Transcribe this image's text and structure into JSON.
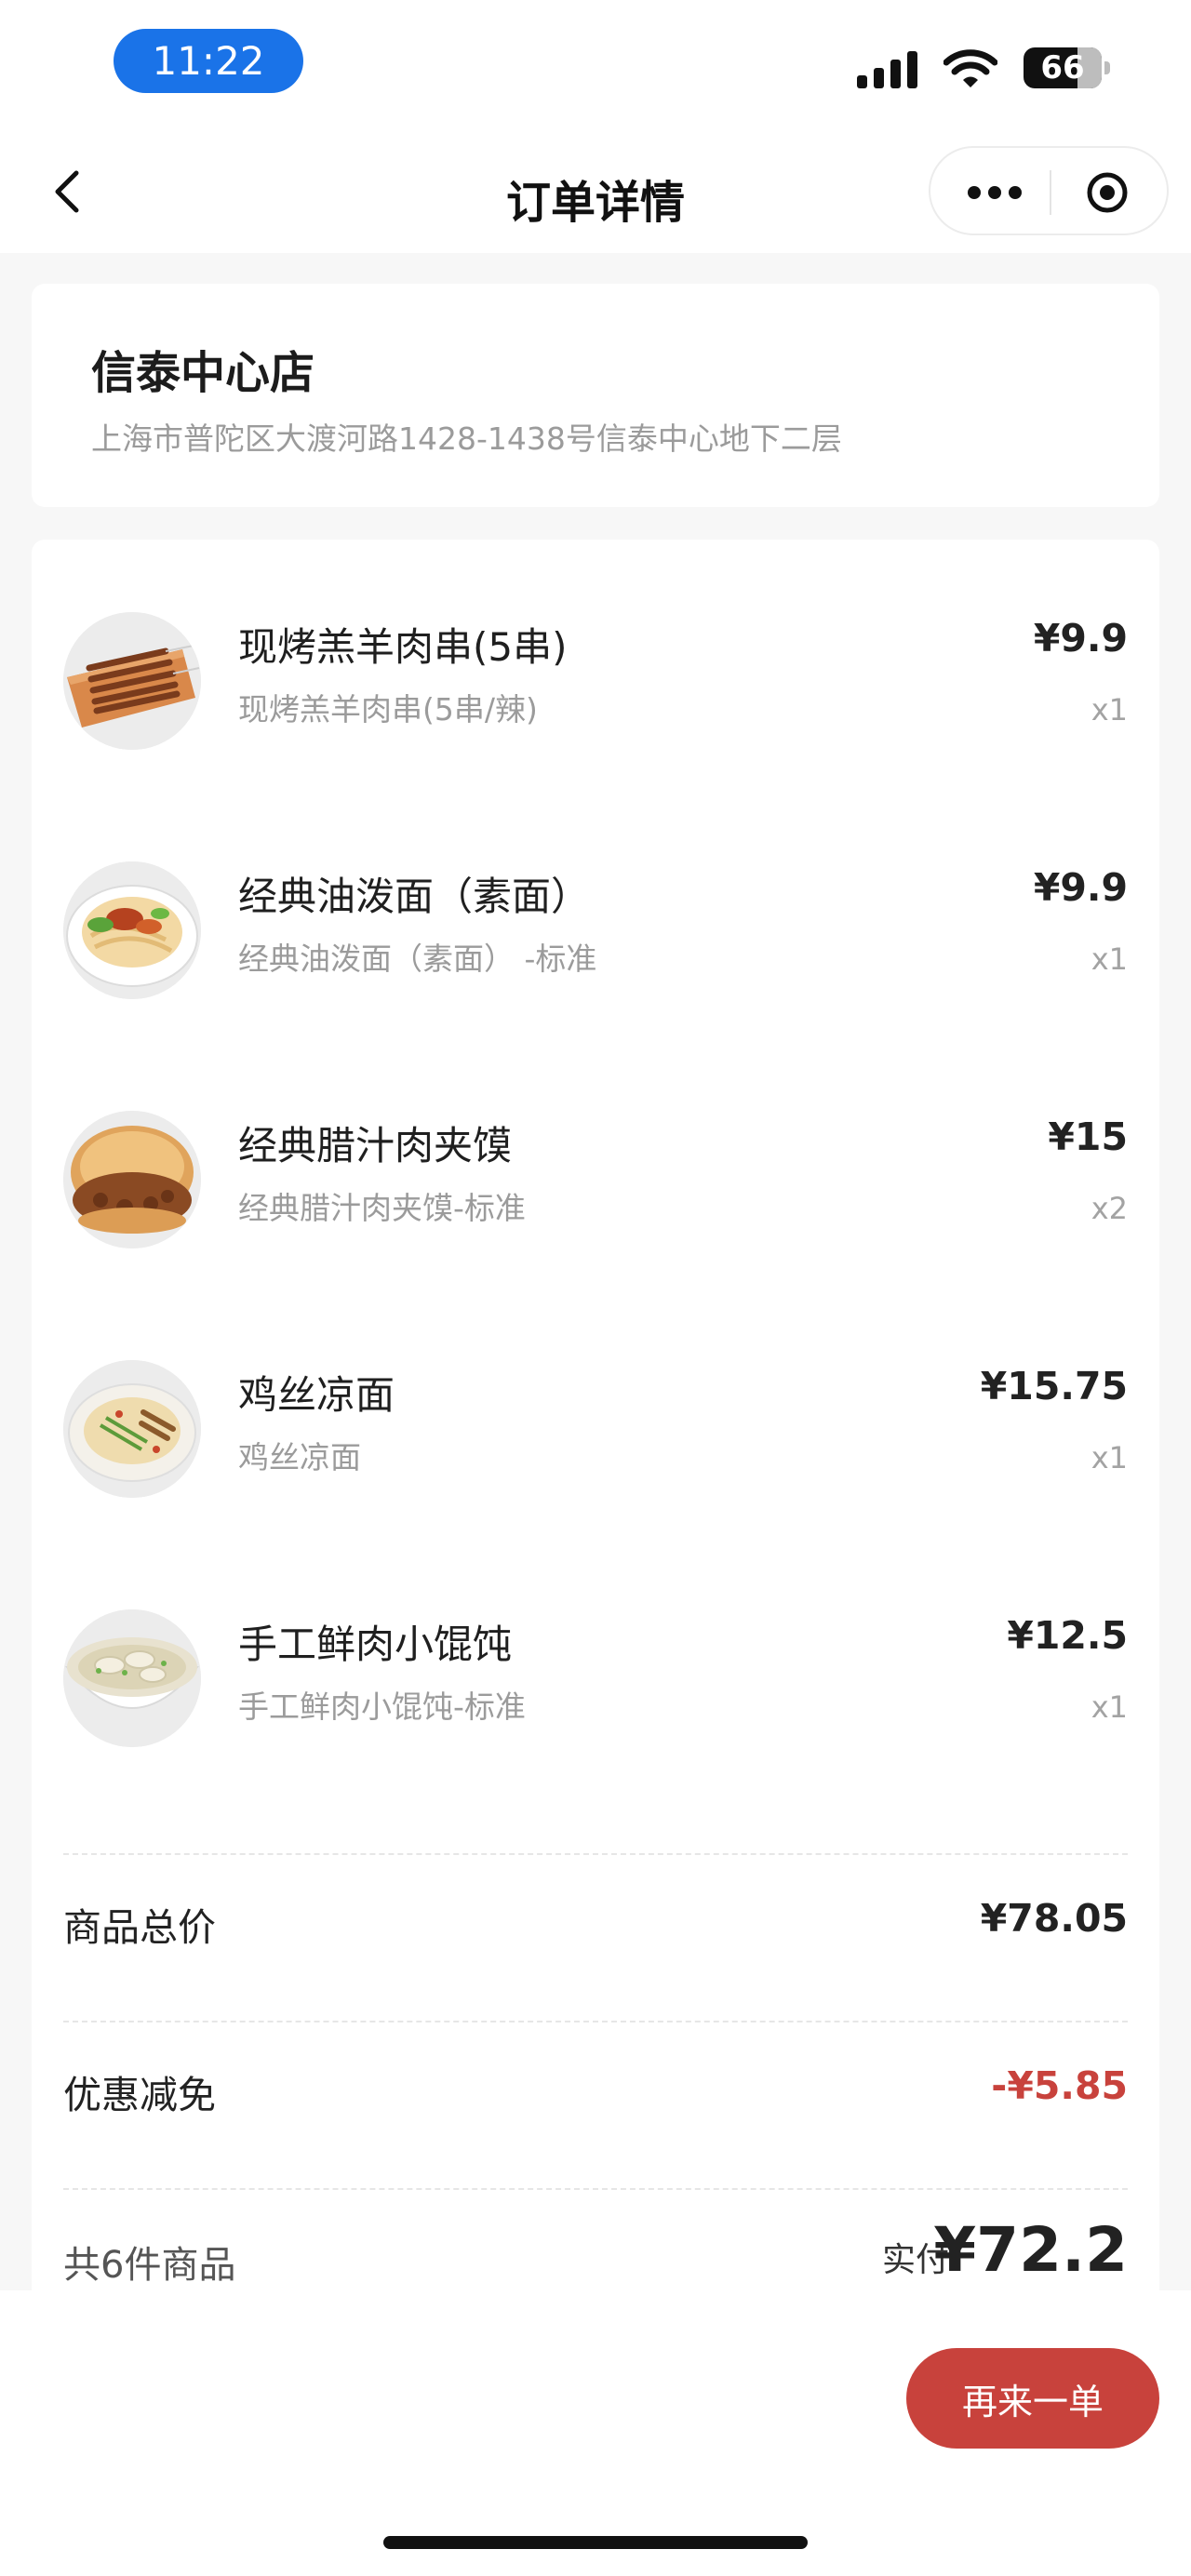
{
  "status_bar": {
    "time": "11:22",
    "battery": "66",
    "icons": [
      "signal-icon",
      "wifi-icon",
      "battery-icon"
    ]
  },
  "nav": {
    "title": "订单详情",
    "back_icon": "chevron-left-icon",
    "more_icon": "more-dots-icon",
    "close_icon": "target-circle-icon"
  },
  "store": {
    "name": "信泰中心店",
    "address": "上海市普陀区大渡河路1428-1438号信泰中心地下二层"
  },
  "items": [
    {
      "name": "现烤羔羊肉串(5串)",
      "spec": "现烤羔羊肉串(5串/辣)",
      "price": "¥9.9",
      "qty": "x1",
      "image": "lamb-skewers"
    },
    {
      "name": "经典油泼面（素面）",
      "spec": "经典油泼面（素面） -标准",
      "price": "¥9.9",
      "qty": "x1",
      "image": "oil-noodles"
    },
    {
      "name": "经典腊汁肉夹馍",
      "spec": "经典腊汁肉夹馍-标准",
      "price": "¥15",
      "qty": "x2",
      "image": "roujiamo"
    },
    {
      "name": "鸡丝凉面",
      "spec": "鸡丝凉面",
      "price": "¥15.75",
      "qty": "x1",
      "image": "cold-noodles"
    },
    {
      "name": "手工鲜肉小馄饨",
      "spec": "手工鲜肉小馄饨-标准",
      "price": "¥12.5",
      "qty": "x1",
      "image": "wonton-soup"
    }
  ],
  "summary": {
    "subtotal_label": "商品总价",
    "subtotal_value": "¥78.05",
    "discount_label": "优惠减免",
    "discount_value": "-¥5.85",
    "count_text": "共6件商品",
    "paid_label": "实付",
    "paid_value": "¥72.2"
  },
  "actions": {
    "reorder_label": "再来一单"
  },
  "colors": {
    "accent_red": "#c8423c",
    "time_pill_blue": "#1a73e8",
    "muted_text": "#9b9b9b"
  }
}
